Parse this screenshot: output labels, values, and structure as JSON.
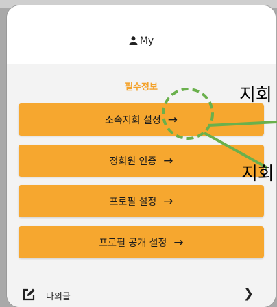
{
  "header": {
    "title": "My",
    "icon": "person-icon"
  },
  "section": {
    "title": "필수정보"
  },
  "buttons": [
    {
      "label": "소속지회 설정",
      "arrow": "→"
    },
    {
      "label": "정회원 인증",
      "arrow": "→"
    },
    {
      "label": "프로필 설정",
      "arrow": "→"
    },
    {
      "label": "프로필 공개 설정",
      "arrow": "→"
    }
  ],
  "menu": {
    "my_posts_label": "나의글",
    "chevron": "›"
  },
  "annotations": {
    "label1": "지회",
    "label2": "지회"
  },
  "colors": {
    "accent": "#f6a72f",
    "section_title": "#f4a22a",
    "annotation": "#6ab04c"
  }
}
